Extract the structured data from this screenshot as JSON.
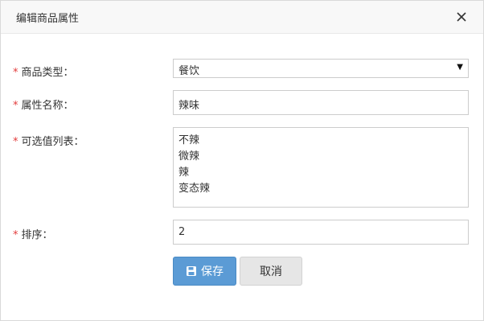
{
  "dialog": {
    "title": "编辑商品属性",
    "close_icon": "close-icon"
  },
  "form": {
    "type": {
      "label": "商品类型：",
      "value": "餐饮"
    },
    "name": {
      "label": "属性名称：",
      "value": "辣味"
    },
    "options": {
      "label": "可选值列表：",
      "values": [
        "不辣",
        "微辣",
        "辣",
        "变态辣"
      ]
    },
    "sort": {
      "label": "排序：",
      "value": "2"
    },
    "required_mark": "*"
  },
  "buttons": {
    "save_label": "保存",
    "save_icon": "save-icon",
    "cancel_label": "取消"
  },
  "colors": {
    "required": "#e23b3b",
    "primary": "#5b9bd5"
  }
}
